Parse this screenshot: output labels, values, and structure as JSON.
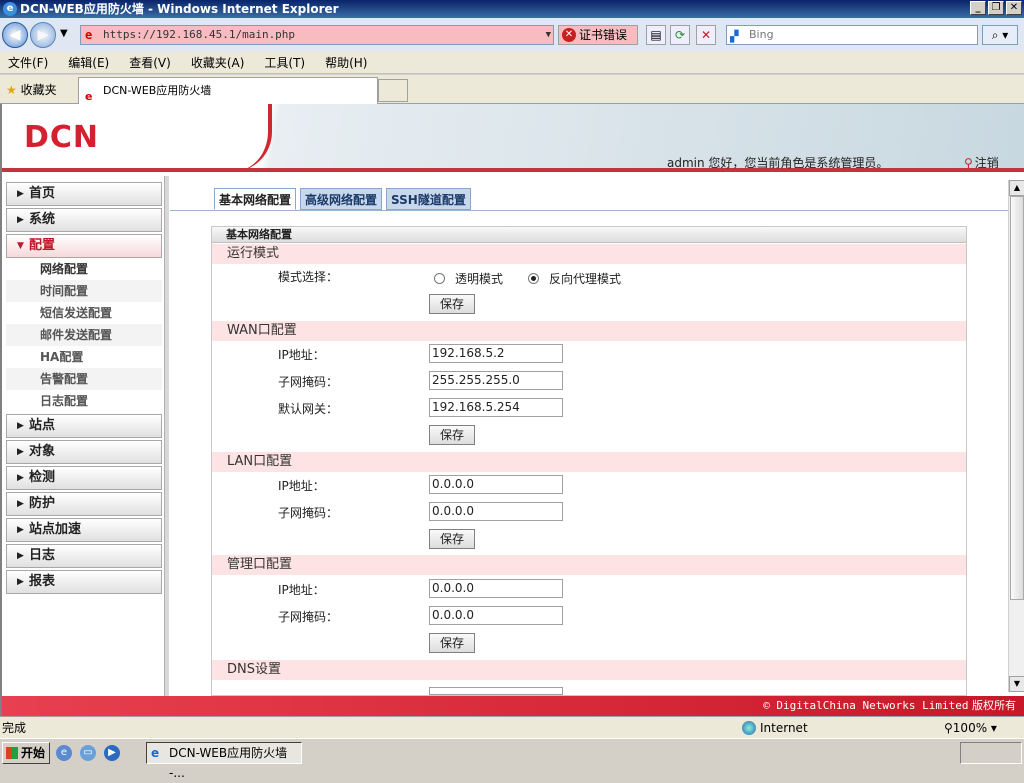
{
  "window": {
    "title": "DCN-WEB应用防火墙 - Windows Internet Explorer"
  },
  "addressbar": {
    "url": "https://192.168.45.1/main.php",
    "cert_error": "证书错误",
    "search_placeholder": "Bing"
  },
  "menubar": {
    "items": [
      "文件(F)",
      "编辑(E)",
      "查看(V)",
      "收藏夹(A)",
      "工具(T)",
      "帮助(H)"
    ]
  },
  "favorites": {
    "label": "收藏夹",
    "tab_title": "DCN-WEB应用防火墙"
  },
  "header": {
    "logo": "DCN",
    "greeting": "admin 您好，您当前角色是系统管理员。",
    "logout": "注销"
  },
  "sidebar": {
    "items": [
      {
        "label": "首页"
      },
      {
        "label": "系统"
      },
      {
        "label": "配置"
      }
    ],
    "sub": [
      {
        "label": "网络配置"
      },
      {
        "label": "时间配置"
      },
      {
        "label": "短信发送配置"
      },
      {
        "label": "邮件发送配置"
      },
      {
        "label": "HA配置"
      },
      {
        "label": "告警配置"
      },
      {
        "label": "日志配置"
      }
    ],
    "items2": [
      {
        "label": "站点"
      },
      {
        "label": "对象"
      },
      {
        "label": "检测"
      },
      {
        "label": "防护"
      },
      {
        "label": "站点加速"
      },
      {
        "label": "日志"
      },
      {
        "label": "报表"
      }
    ]
  },
  "tabs": [
    {
      "label": "基本网络配置"
    },
    {
      "label": "高级网络配置"
    },
    {
      "label": "SSH隧道配置"
    }
  ],
  "panel": {
    "title": "基本网络配置",
    "run_mode": {
      "heading": "运行模式",
      "label": "模式选择：",
      "opt1": "透明模式",
      "opt2": "反向代理模式",
      "save": "保存"
    },
    "wan": {
      "heading": "WAN口配置",
      "ip_label": "IP地址：",
      "ip": "192.168.5.2",
      "mask_label": "子网掩码：",
      "mask": "255.255.255.0",
      "gw_label": "默认网关：",
      "gw": "192.168.5.254",
      "save": "保存"
    },
    "lan": {
      "heading": "LAN口配置",
      "ip_label": "IP地址：",
      "ip": "0.0.0.0",
      "mask_label": "子网掩码：",
      "mask": "0.0.0.0",
      "save": "保存"
    },
    "mgmt": {
      "heading": "管理口配置",
      "ip_label": "IP地址：",
      "ip": "0.0.0.0",
      "mask_label": "子网掩码：",
      "mask": "0.0.0.0",
      "save": "保存"
    },
    "dns": {
      "heading": "DNS设置"
    }
  },
  "footer": {
    "copyright": "© DigitalChina Networks Limited",
    "rights": "版权所有"
  },
  "status": {
    "left": "完成",
    "zone": "Internet",
    "zoom": "100%"
  },
  "taskbar": {
    "start": "开始",
    "task": "DCN-WEB应用防火墙 -..."
  }
}
